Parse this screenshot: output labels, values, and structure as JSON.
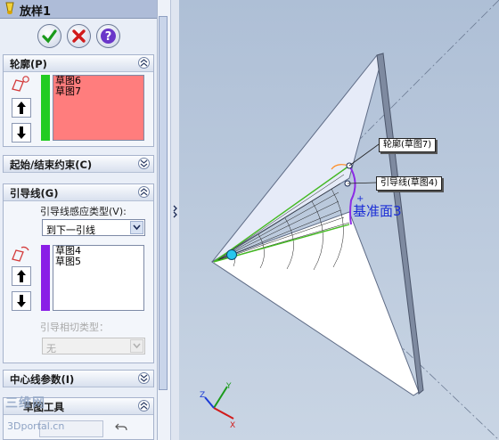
{
  "window": {
    "title": "放样1"
  },
  "actions": {
    "ok": "ok",
    "cancel": "cancel",
    "help": "help"
  },
  "profiles": {
    "header": "轮廓(P)",
    "items": [
      "草图6",
      "草图7"
    ]
  },
  "constraints": {
    "header": "起始/结束约束(C)"
  },
  "guides": {
    "header": "引导线(G)",
    "influence_label": "引导线感应类型(V):",
    "influence_value": "到下一引线",
    "items": [
      "草图4",
      "草图5"
    ],
    "tangency_label": "引导相切类型：",
    "tangency_value": "无"
  },
  "centerline": {
    "header": "中心线参数(I)"
  },
  "sketch_tools": {
    "header": "草图工具"
  },
  "viewport": {
    "callout_profile": "轮廓(草图7)",
    "callout_guide": "引导线(草图4)",
    "plane_label": "基准面3",
    "axis_x": "X",
    "axis_y": "Y",
    "axis_z": "Z"
  },
  "colors": {
    "profile_strip": "#22cc22",
    "guide_strip": "#8a1ee6",
    "profile_list_bg": "#ff7d7d",
    "viewport_bg": "#b8c7db"
  },
  "watermark": {
    "line1": "三维网",
    "line2": "3Dportal.cn"
  }
}
